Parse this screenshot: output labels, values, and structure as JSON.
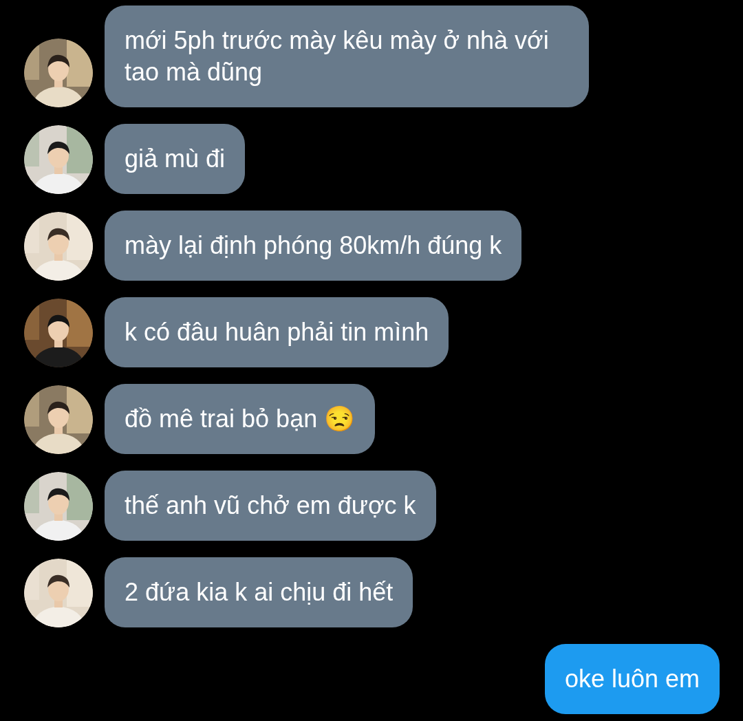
{
  "messages": [
    {
      "kind": "incoming",
      "text": "mới 5ph trước mày kêu mày ở nhà với tao mà dũng"
    },
    {
      "kind": "incoming",
      "text": "giả mù đi"
    },
    {
      "kind": "incoming",
      "text": "mày lại định phóng 80km/h đúng k"
    },
    {
      "kind": "incoming",
      "text": "k có đâu huân phải tin mình"
    },
    {
      "kind": "incoming",
      "text": "đồ mê trai bỏ bạn 😒"
    },
    {
      "kind": "incoming",
      "text": "thế anh vũ chở em được k"
    },
    {
      "kind": "incoming",
      "text": "2 đứa kia k ai chịu đi hết"
    },
    {
      "kind": "outgoing",
      "text": "oke luôn em"
    }
  ]
}
